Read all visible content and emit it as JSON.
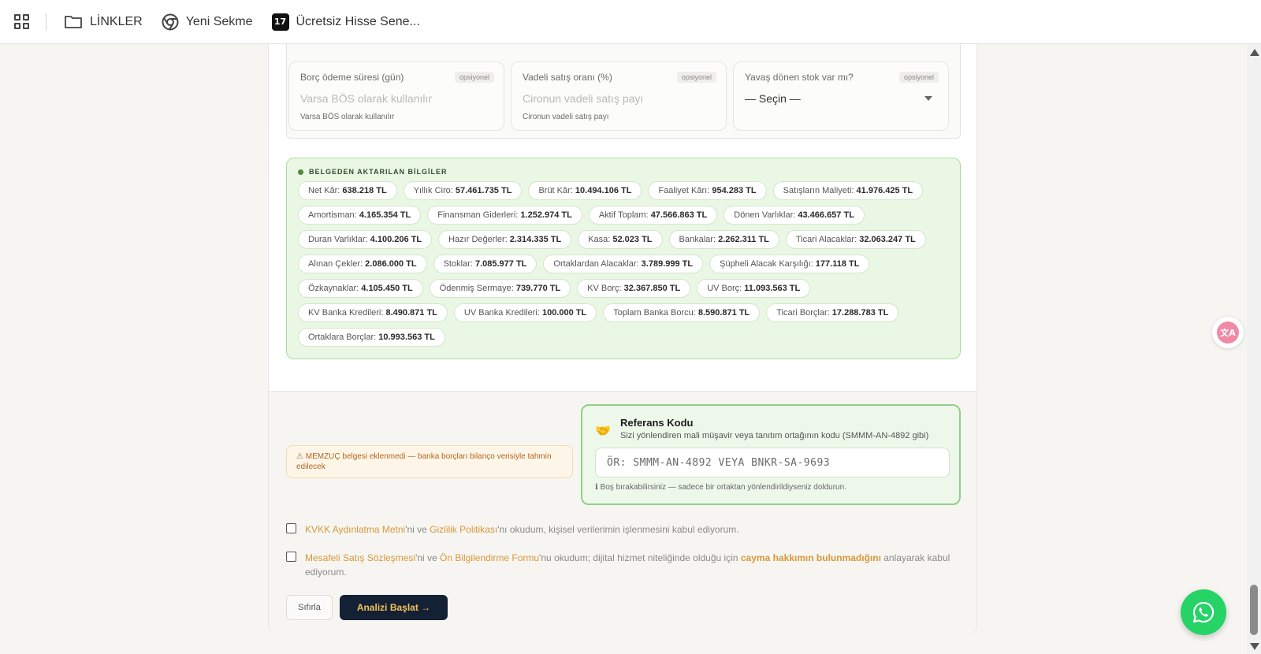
{
  "bookmarks": {
    "items": [
      {
        "label": "LİNKLER",
        "icon": "folder-icon"
      },
      {
        "label": "Yeni Sekme",
        "icon": "chrome-icon"
      },
      {
        "label": "Ücretsiz Hisse Sene...",
        "icon": "tradingview-icon",
        "logo_text": "17"
      }
    ]
  },
  "optional_fields": {
    "badge": "opsiyonel",
    "debt_days": {
      "label": "Borç ödeme süresi (gün)",
      "placeholder": "Varsa BÖS olarak kullanılır",
      "hint": "Varsa BÖS olarak kullanılır"
    },
    "forward_sales": {
      "label": "Vadeli satış oranı (%)",
      "placeholder": "Cironun vadeli satış payı",
      "hint": "Cironun vadeli satış payı"
    },
    "slow_stock": {
      "label": "Yavaş dönen stok var mı?",
      "selected": "— Seçin —"
    }
  },
  "extracted": {
    "title": "BELGEDEN AKTARILAN BİLGİLER",
    "chips": [
      {
        "label": "Net Kâr:",
        "value": "638.218 TL"
      },
      {
        "label": "Yıllık Ciro:",
        "value": "57.461.735 TL"
      },
      {
        "label": "Brüt Kâr:",
        "value": "10.494.106 TL"
      },
      {
        "label": "Faaliyet Kârı:",
        "value": "954.283 TL"
      },
      {
        "label": "Satışların Maliyeti:",
        "value": "41.976.425 TL"
      },
      {
        "label": "Amortisman:",
        "value": "4.165.354 TL"
      },
      {
        "label": "Finansman Giderleri:",
        "value": "1.252.974 TL"
      },
      {
        "label": "Aktif Toplam:",
        "value": "47.566.863 TL"
      },
      {
        "label": "Dönen Varlıklar:",
        "value": "43.466.657 TL"
      },
      {
        "label": "Duran Varlıklar:",
        "value": "4.100.206 TL"
      },
      {
        "label": "Hazır Değerler:",
        "value": "2.314.335 TL"
      },
      {
        "label": "Kasa:",
        "value": "52.023 TL"
      },
      {
        "label": "Bankalar:",
        "value": "2.262.311 TL"
      },
      {
        "label": "Ticari Alacaklar:",
        "value": "32.063.247 TL"
      },
      {
        "label": "Alınan Çekler:",
        "value": "2.086.000 TL"
      },
      {
        "label": "Stoklar:",
        "value": "7.085.977 TL"
      },
      {
        "label": "Ortaklardan Alacaklar:",
        "value": "3.789.999 TL"
      },
      {
        "label": "Şüpheli Alacak Karşılığı:",
        "value": "177.118 TL"
      },
      {
        "label": "Özkaynaklar:",
        "value": "4.105.450 TL"
      },
      {
        "label": "Ödenmiş Sermaye:",
        "value": "739.770 TL"
      },
      {
        "label": "KV Borç:",
        "value": "32.367.850 TL"
      },
      {
        "label": "UV Borç:",
        "value": "11.093.563 TL"
      },
      {
        "label": "KV Banka Kredileri:",
        "value": "8.490.871 TL"
      },
      {
        "label": "UV Banka Kredileri:",
        "value": "100.000 TL"
      },
      {
        "label": "Toplam Banka Borcu:",
        "value": "8.590.871 TL"
      },
      {
        "label": "Ticari Borçlar:",
        "value": "17.288.783 TL"
      },
      {
        "label": "Ortaklara Borçlar:",
        "value": "10.993.563 TL"
      }
    ]
  },
  "warning": "⚠ MEMZUÇ belgesi eklenmedi — banka borçları bilanço verisiyle tahmin edilecek",
  "referral": {
    "icon": "handshake-icon",
    "title": "Referans Kodu",
    "subtitle": "Sizi yönlendiren mali müşavir veya tanıtım ortağının kodu (SMMM-AN-4892 gibi)",
    "placeholder": "ÖR: SMMM-AN-4892 VEYA BNKR-SA-9693",
    "note": "ℹ Boş bırakabilirsiniz — sadece bir ortaktan yönlendirildiyseniz doldurun."
  },
  "consents": {
    "kvkk": {
      "link1": "KVKK Aydınlatma Metni",
      "t1": "'ni ve ",
      "link2": "Gizlilik Politikası",
      "t2": "'nı okudum, kişisel verilerimin işlenmesini kabul ediyorum."
    },
    "sales": {
      "link1": "Mesafeli Satış Sözleşmesi",
      "t1": "'ni ve ",
      "link2": "Ön Bilgilendirme Formu",
      "t2": "'nu okudum; dijital hizmet niteliğinde olduğu için ",
      "link3": "cayma hakkımın bulunmadığını",
      "t3": " anlayarak kabul ediyorum."
    }
  },
  "actions": {
    "reset": "Sıfırla",
    "start": "Analizi Başlat →"
  },
  "floating": {
    "translate_text": "文A"
  },
  "colors": {
    "accent": "#d9983a",
    "primary_button": "#142033",
    "success_border": "#8fd08a",
    "whatsapp": "#25d366"
  }
}
